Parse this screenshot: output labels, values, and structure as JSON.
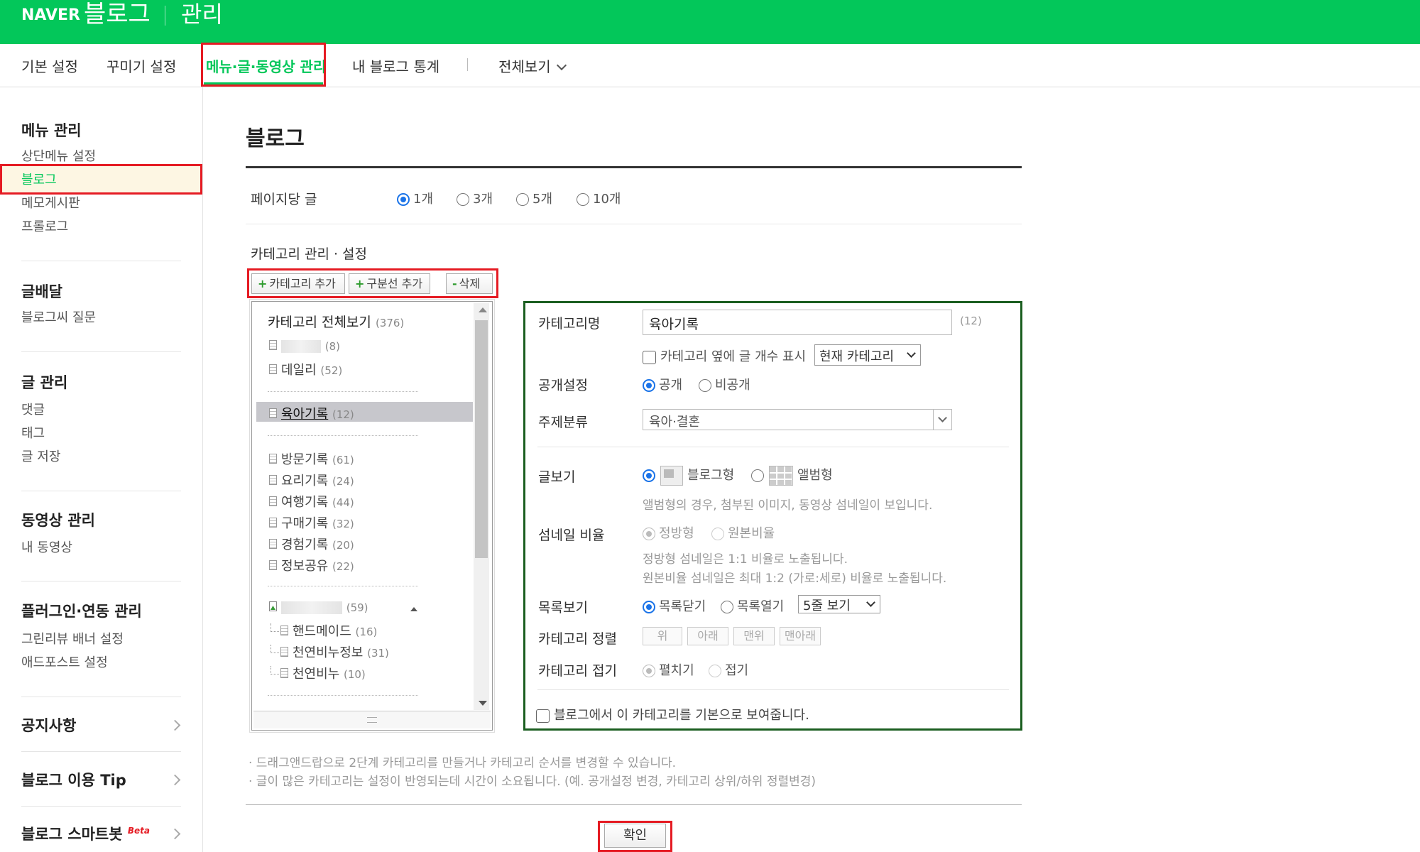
{
  "header": {
    "brand": "NAVER",
    "blog": "블로그",
    "admin": "관리"
  },
  "tabs": [
    {
      "label": "기본 설정"
    },
    {
      "label": "꾸미기 설정"
    },
    {
      "label": "메뉴·글·동영상 관리"
    },
    {
      "label": "내 블로그 통계"
    },
    {
      "label": "전체보기"
    }
  ],
  "sidebar": {
    "menu_title": "메뉴 관리",
    "menu_items": [
      "상단메뉴 설정",
      "블로그",
      "메모게시판",
      "프롤로그"
    ],
    "delivery_title": "글배달",
    "delivery_items": [
      "블로그씨 질문"
    ],
    "post_title": "글 관리",
    "post_items": [
      "댓글",
      "태그",
      "글 저장"
    ],
    "video_title": "동영상 관리",
    "video_items": [
      "내 동영상"
    ],
    "plugin_title": "플러그인·연동 관리",
    "plugin_items": [
      "그린리뷰 배너 설정",
      "애드포스트 설정"
    ],
    "notice": "공지사항",
    "tip": "블로그 이용 Tip",
    "smartbot": "블로그 스마트봇",
    "beta": "Beta"
  },
  "main": {
    "title": "블로그",
    "per_page_label": "페이지당 글",
    "per_page_options": [
      "1개",
      "3개",
      "5개",
      "10개"
    ],
    "per_page_selected": 0,
    "category_section_label": "카테고리 관리 · 설정",
    "buttons": {
      "add_category": "카테고리 추가",
      "add_divider": "구분선 추가",
      "delete": "삭제"
    }
  },
  "tree": {
    "header": "카테고리 전체보기",
    "header_count": "(376)",
    "items": [
      {
        "label": "",
        "count": "(8)"
      },
      {
        "label": "데일리",
        "count": "(52)"
      },
      {
        "label": "육아기록",
        "count": "(12)"
      },
      {
        "label": "방문기록",
        "count": "(61)"
      },
      {
        "label": "요리기록",
        "count": "(24)"
      },
      {
        "label": "여행기록",
        "count": "(44)"
      },
      {
        "label": "구매기록",
        "count": "(32)"
      },
      {
        "label": "경험기록",
        "count": "(20)"
      },
      {
        "label": "정보공유",
        "count": "(22)"
      },
      {
        "label": "",
        "count": "(59)"
      },
      {
        "label": "핸드메이드",
        "count": "(16)"
      },
      {
        "label": "천연비누정보",
        "count": "(31)"
      },
      {
        "label": "천연비누",
        "count": "(10)"
      }
    ]
  },
  "panel": {
    "name_label": "카테고리명",
    "name_value": "육아기록",
    "name_count": "(12)",
    "show_count_label": "카테고리 옆에 글 개수 표시",
    "show_count_select": "현재 카테고리",
    "visibility_label": "공개설정",
    "visibility_public": "공개",
    "visibility_private": "비공개",
    "topic_label": "주제분류",
    "topic_value": "육아·결혼",
    "view_label": "글보기",
    "view_blog": "블로그형",
    "view_album": "앨범형",
    "view_help": "앨범형의 경우, 첨부된 이미지, 동영상 섬네일이 보입니다.",
    "thumb_label": "섬네일 비율",
    "thumb_square": "정방형",
    "thumb_original": "원본비율",
    "thumb_help1": "정방형 섬네일은 1:1 비율로 노출됩니다.",
    "thumb_help2": "원본비율 섬네일은 최대 1:2 (가로:세로) 비율로 노출됩니다.",
    "list_label": "목록보기",
    "list_close": "목록닫기",
    "list_open": "목록열기",
    "list_select": "5줄 보기",
    "sort_label": "카테고리 정렬",
    "sort_buttons": [
      "위",
      "아래",
      "맨위",
      "맨아래"
    ],
    "fold_label": "카테고리 접기",
    "fold_expand": "펼치기",
    "fold_collapse": "접기",
    "default_label": "블로그에서 이 카테고리를 기본으로 보여줍니다."
  },
  "notes": [
    "· 드래그앤드랍으로 2단계 카테고리를 만들거나 카테고리 순서를 변경할 수 있습니다.",
    "· 글이 많은 카테고리는 설정이 반영되는데 시간이 소요됩니다. (예. 공개설정 변경, 카테고리 상위/하위 정렬변경)"
  ],
  "confirm": "확인",
  "colors": {
    "brand_green": "#03c75a",
    "highlight_red": "#e51b23",
    "panel_border": "#1b5e20",
    "radio_blue": "#1a73e8"
  }
}
